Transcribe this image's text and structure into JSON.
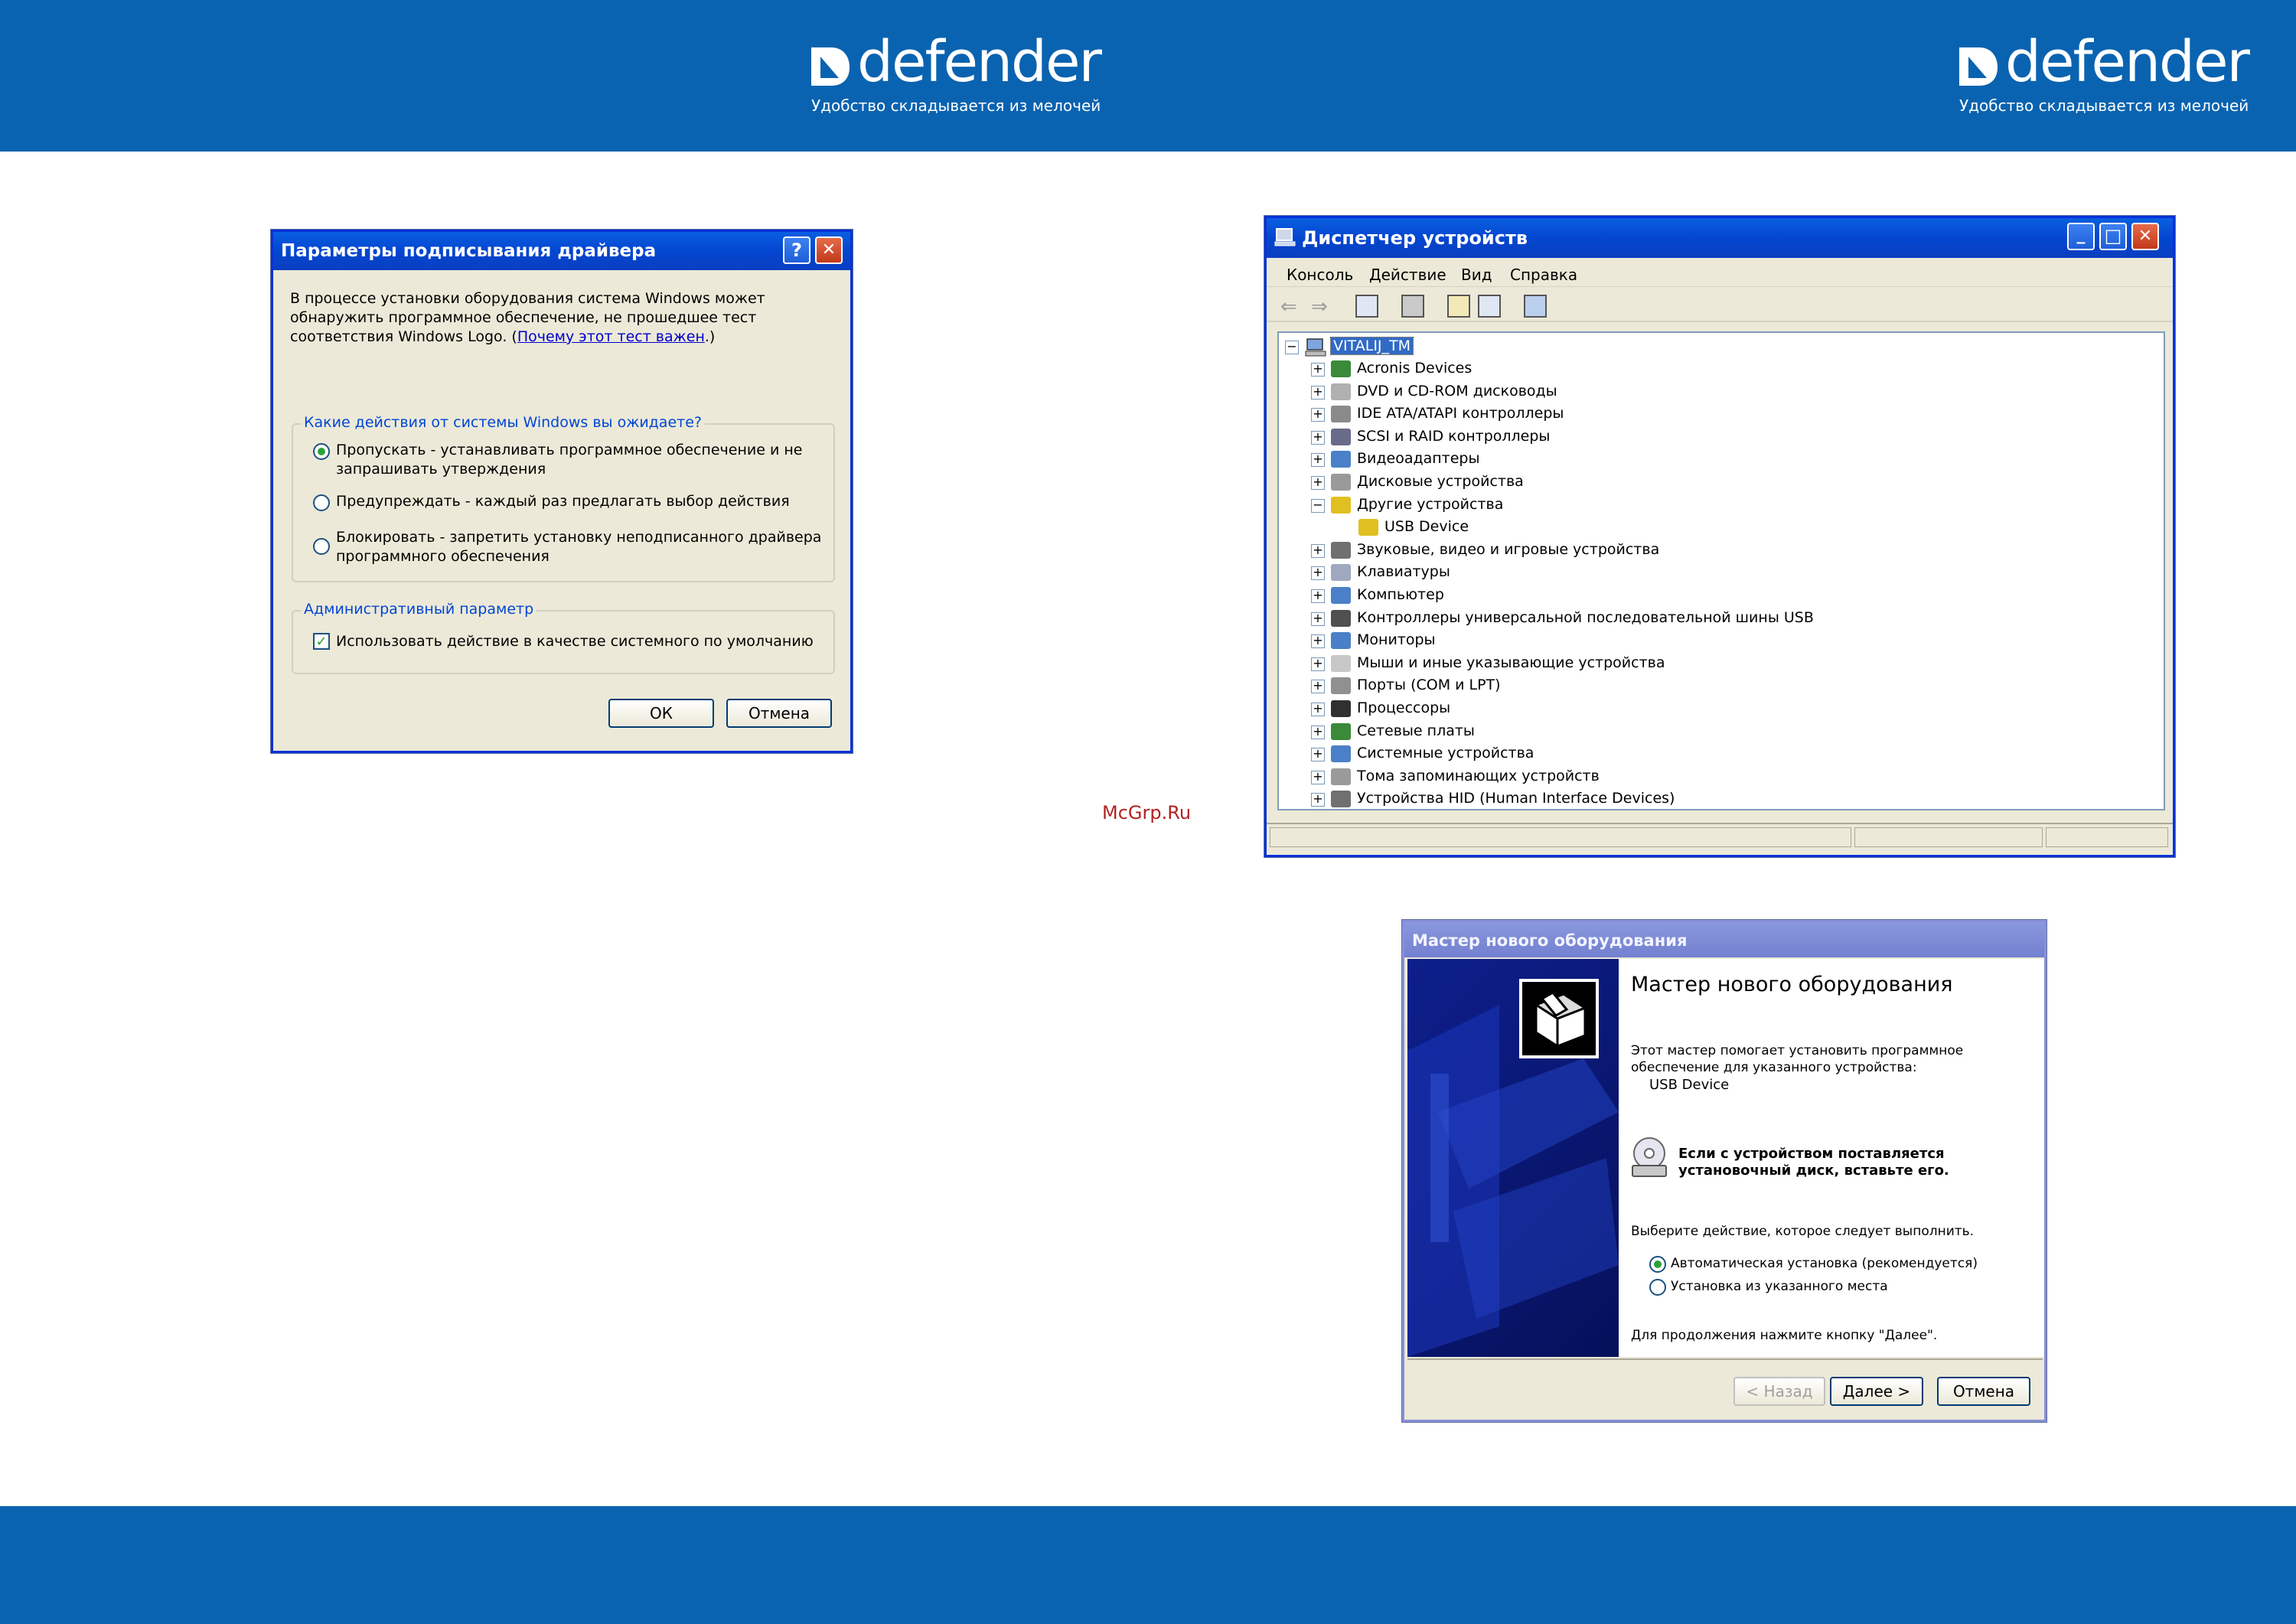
{
  "brand": {
    "name": "defender",
    "slogan": "Удобство складывается из мелочей",
    "colors": {
      "band": "#0a63b0",
      "text": "#ffffff"
    }
  },
  "watermark": "McGrp.Ru",
  "signing_dialog": {
    "title": "Параметры подписывания драйвера",
    "help_button": "?",
    "close_button": "✕",
    "intro_lines": [
      "В процессе установки оборудования система Windows может",
      "обнаружить программное обеспечение, не прошедшее тест",
      "соответствия Windows Logo. ("
    ],
    "intro_link": "Почему этот тест важен",
    "intro_close": ".)",
    "actions_group": "Какие действия от системы Windows вы ожидаете?",
    "options": [
      {
        "line1": "Пропускать - устанавливать программное обеспечение и не",
        "line2": "запрашивать утверждения",
        "selected": true
      },
      {
        "line1": "Предупреждать - каждый раз предлагать выбор действия",
        "line2": "",
        "selected": false
      },
      {
        "line1": "Блокировать - запретить установку неподписанного драйвера",
        "line2": "программного обеспечения",
        "selected": false
      }
    ],
    "admin_group": "Административный параметр",
    "checkbox_label": "Использовать действие в качестве системного по умолчанию",
    "checkbox_checked": true,
    "ok": "ОК",
    "cancel": "Отмена"
  },
  "device_manager": {
    "title": "Диспетчер устройств",
    "menu": [
      "Консоль",
      "Действие",
      "Вид",
      "Справка"
    ],
    "toolbar_icons": [
      "back-arrow-icon",
      "forward-arrow-icon",
      "console-tree-icon",
      "print-icon",
      "properties-icon",
      "help-icon",
      "scan-hardware-icon"
    ],
    "root": "VITALIJ_TM",
    "items": [
      {
        "label": "Acronis Devices",
        "expander": "+",
        "icon_color": "#3a8a3a",
        "level": 1
      },
      {
        "label": "DVD и CD-ROM дисководы",
        "expander": "+",
        "icon_color": "#b0b0b0",
        "level": 1
      },
      {
        "label": "IDE ATA/ATAPI контроллеры",
        "expander": "+",
        "icon_color": "#8a8a8a",
        "level": 1
      },
      {
        "label": "SCSI и RAID контроллеры",
        "expander": "+",
        "icon_color": "#6a6a8a",
        "level": 1
      },
      {
        "label": "Видеоадаптеры",
        "expander": "+",
        "icon_color": "#4a80c8",
        "level": 1
      },
      {
        "label": "Дисковые устройства",
        "expander": "+",
        "icon_color": "#9a9a9a",
        "level": 1
      },
      {
        "label": "Другие устройства",
        "expander": "−",
        "icon_color": "#e0c020",
        "level": 1
      },
      {
        "label": "USB Device",
        "expander": "",
        "icon_color": "#e0c020",
        "level": 2
      },
      {
        "label": "Звуковые, видео и игровые устройства",
        "expander": "+",
        "icon_color": "#707070",
        "level": 1
      },
      {
        "label": "Клавиатуры",
        "expander": "+",
        "icon_color": "#a0a8c0",
        "level": 1
      },
      {
        "label": "Компьютер",
        "expander": "+",
        "icon_color": "#4a80c8",
        "level": 1
      },
      {
        "label": "Контроллеры универсальной последовательной шины USB",
        "expander": "+",
        "icon_color": "#505050",
        "level": 1
      },
      {
        "label": "Мониторы",
        "expander": "+",
        "icon_color": "#4a80c8",
        "level": 1
      },
      {
        "label": "Мыши и иные указывающие устройства",
        "expander": "+",
        "icon_color": "#c8c8c8",
        "level": 1
      },
      {
        "label": "Порты (COM и LPT)",
        "expander": "+",
        "icon_color": "#909090",
        "level": 1
      },
      {
        "label": "Процессоры",
        "expander": "+",
        "icon_color": "#303030",
        "level": 1
      },
      {
        "label": "Сетевые платы",
        "expander": "+",
        "icon_color": "#3a8a3a",
        "level": 1
      },
      {
        "label": "Системные устройства",
        "expander": "+",
        "icon_color": "#4a80c8",
        "level": 1
      },
      {
        "label": "Тома запоминающих устройств",
        "expander": "+",
        "icon_color": "#9a9a9a",
        "level": 1
      },
      {
        "label": "Устройства HID (Human Interface Devices)",
        "expander": "+",
        "icon_color": "#707070",
        "level": 1
      }
    ],
    "minimize": "_",
    "maximize": "□",
    "close": "✕"
  },
  "hardware_wizard": {
    "title": "Мастер нового оборудования",
    "heading": "Мастер нового оборудования",
    "intro_line1": "Этот мастер помогает установить программное",
    "intro_line2": "обеспечение для указанного устройства:",
    "device": "USB Device",
    "cd_line1": "Если с устройством поставляется",
    "cd_line2": "установочный диск, вставьте его.",
    "prompt": "Выберите действие, которое следует выполнить.",
    "options": [
      {
        "label": "Автоматическая установка (рекомендуется)",
        "selected": true
      },
      {
        "label": "Установка из указанного места",
        "selected": false
      }
    ],
    "continue_hint": "Для продолжения нажмите кнопку \"Далее\".",
    "back": "< Назад",
    "next": "Далее >",
    "cancel": "Отмена"
  }
}
